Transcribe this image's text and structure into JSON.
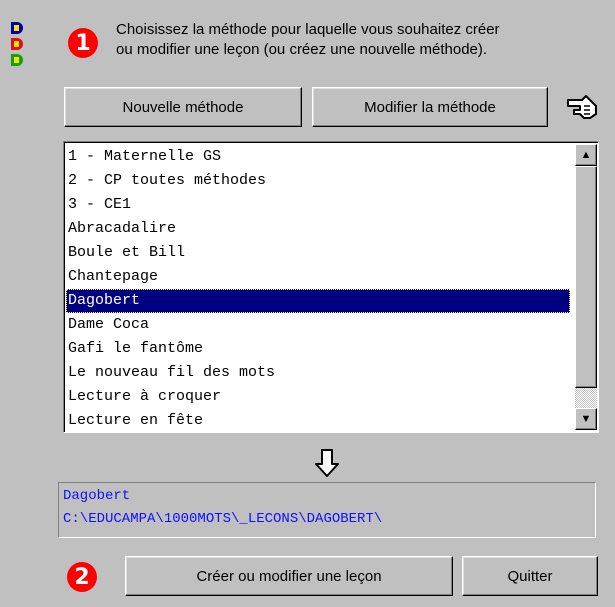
{
  "instruction": "Choisissez la méthode pour laquelle vous souhaitez créer ou modifier une leçon (ou créez une nouvelle méthode).",
  "instruction_lines": [
    "Choisissez la méthode pour laquelle vous souhaitez créer",
    "ou modifier une leçon (ou créez une nouvelle méthode)."
  ],
  "step1": "1",
  "step2": "2",
  "buttons": {
    "new_method": "Nouvelle méthode",
    "edit_method": "Modifier la méthode",
    "create_lesson": "Créer ou modifier une leçon",
    "quit": "Quitter"
  },
  "methods": [
    "1 - Maternelle GS",
    "2 - CP toutes méthodes",
    "3 - CE1",
    "Abracadalire",
    "Boule et Bill",
    "Chantepage",
    "Dagobert",
    "Dame Coca",
    "Gafi le fantôme",
    "Le nouveau fil des mots",
    "Lecture à croquer",
    "Lecture en fête"
  ],
  "selected_index": 6,
  "selection": {
    "name": "Dagobert",
    "path": "C:\\EDUCAMPA\\1000MOTS\\_LECONS\\DAGOBERT\\"
  },
  "colors": {
    "selection": "#000080",
    "path_text": "#1010ff",
    "badge": "#ff0000"
  },
  "icons": {
    "logo": "educampa-logo",
    "hand": "pointing-hand-icon",
    "arrow": "down-arrow-icon"
  }
}
